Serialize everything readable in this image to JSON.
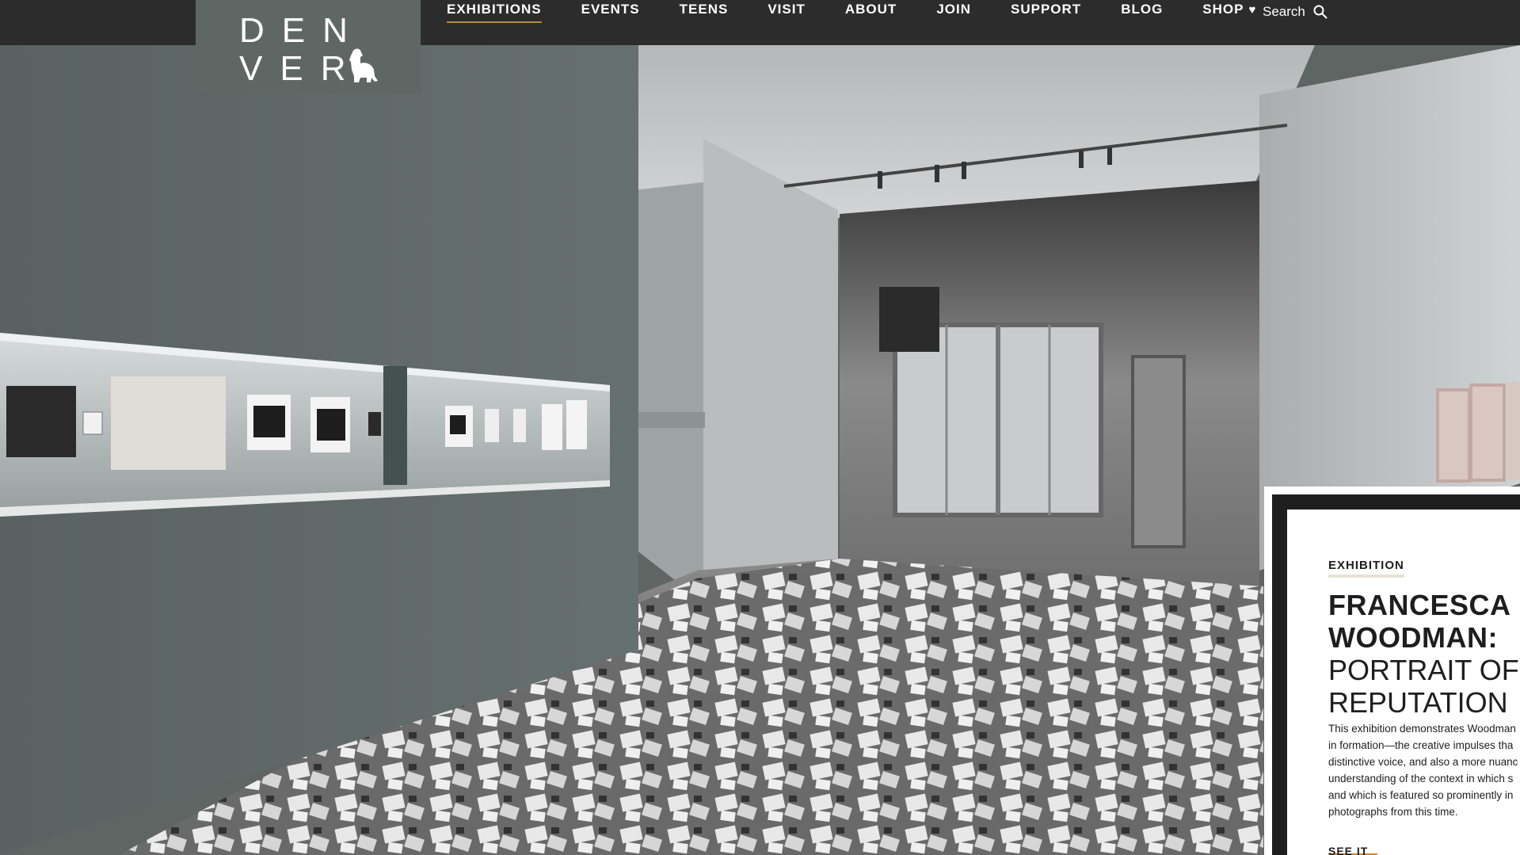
{
  "brand": {
    "logo_line1": "DEN",
    "logo_line2": "VER",
    "logo_icon": "dog-icon"
  },
  "nav": {
    "items": [
      {
        "label": "EXHIBITIONS",
        "active": true
      },
      {
        "label": "EVENTS"
      },
      {
        "label": "TEENS"
      },
      {
        "label": "VISIT"
      },
      {
        "label": "ABOUT"
      },
      {
        "label": "JOIN"
      },
      {
        "label": "SUPPORT"
      },
      {
        "label": "BLOG"
      },
      {
        "label": "SHOP",
        "icon": "heart-icon"
      }
    ],
    "search_label": "Search",
    "search_icon": "search-icon"
  },
  "colors": {
    "nav_bg": "#2c2c2c",
    "active_underline": "#b58d3a",
    "cta_underline": "#c8892e",
    "logo_bg": "#5f6765"
  },
  "feature_card": {
    "eyebrow": "EXHIBITION",
    "title_line1": "FRANCESCA",
    "title_line2": "WOODMAN:",
    "title_line3": "PORTRAIT OF A",
    "title_line4": "REPUTATION",
    "description": "This exhibition demonstrates Woodman\nin formation—the creative impulses tha\ndistinctive voice, and also a more nuanc\nunderstanding of the context in which s\nand which is featured so prominently in\nphotographs from this time.",
    "cta_label": "SEE IT"
  }
}
